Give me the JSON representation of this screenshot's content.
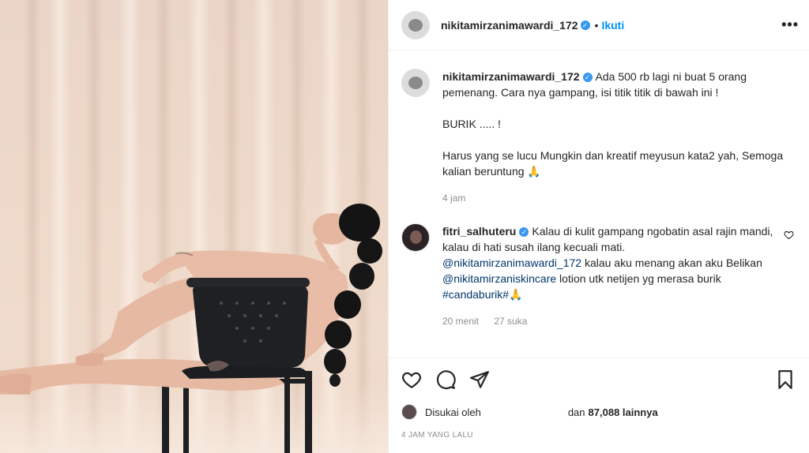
{
  "post": {
    "username": "nikitamirzanimawardi_172",
    "follow_label": "Ikuti",
    "separator": "•",
    "more_icon": "more-options-icon"
  },
  "caption": {
    "username": "nikitamirzanimawardi_172",
    "text": "Ada 500 rb lagi ni buat 5 orang pemenang. Cara nya gampang, isi titik titik di bawah ini !\n\nBURIK ..... !\n\nHarus yang se lucu Mungkin dan kreatif meyusun kata2 yah, Semoga kalian beruntung 🙏",
    "time": "4 jam"
  },
  "comment": {
    "username": "fitri_salhuteru",
    "text_1": "Kalau di kulit gampang ngobatin asal rajin mandi, kalau di hati susah ilang kecuali mati.",
    "mention_1": "@nikitamirzanimawardi_172",
    "text_2": " kalau aku menang akan aku Belikan ",
    "mention_2": "@nikitamirzaniskincare",
    "text_3": " lotion utk netijen yg merasa burik",
    "hashtag": "#candaburik#🙏",
    "time": "20 menit",
    "likes": "27 suka"
  },
  "actions": {
    "like_icon": "heart-icon",
    "comment_icon": "comment-icon",
    "share_icon": "share-icon",
    "save_icon": "bookmark-icon"
  },
  "likes": {
    "prefix": "Disukai oleh",
    "middle": "dan",
    "count": "87,088 lainnya"
  },
  "timestamp": "4 JAM YANG LALU",
  "colors": {
    "accent": "#0095f6",
    "link": "#00376b",
    "muted": "#8e8e8e",
    "verified": "#3897f0"
  }
}
